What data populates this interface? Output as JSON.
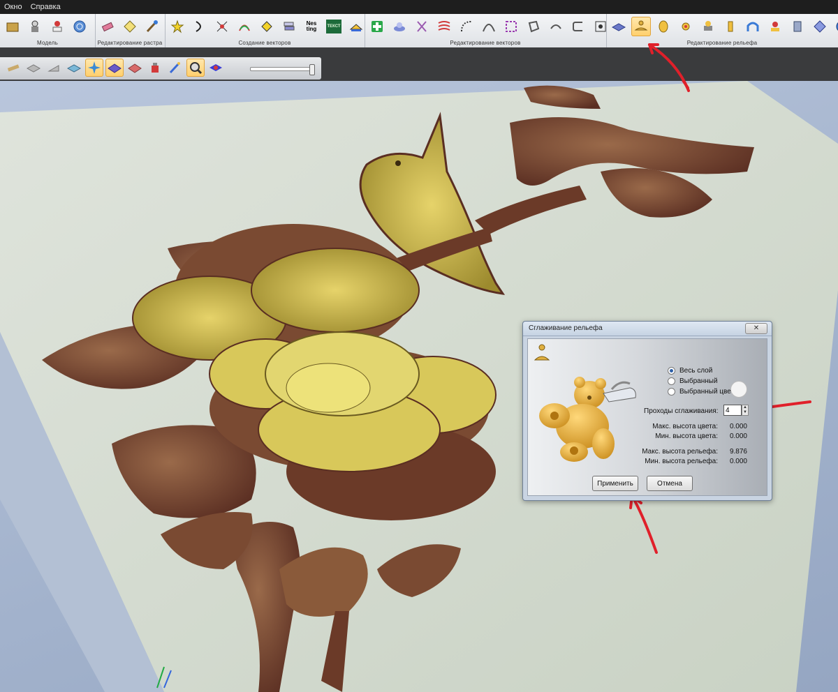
{
  "menu": {
    "items": [
      "Окно",
      "Справка"
    ]
  },
  "ribbon": {
    "groups": [
      {
        "label": "Модель"
      },
      {
        "label": "Редактирование растра"
      },
      {
        "label": "Создание векторов"
      },
      {
        "label": "Редактирование векторов"
      },
      {
        "label": "Редактирование рельефа"
      }
    ],
    "vector_tool_text": {
      "nesting": "Nes ting",
      "text": "ТЕКСТ"
    }
  },
  "dialog": {
    "title": "Сглаживание рельефа",
    "close_label": "✕",
    "radios": [
      {
        "label": "Весь слой",
        "checked": true
      },
      {
        "label": "Выбранный",
        "checked": false
      },
      {
        "label": "Выбранный цвет",
        "checked": false
      }
    ],
    "passes": {
      "label": "Проходы сглаживания:",
      "value": "4"
    },
    "stats": [
      {
        "label": "Макс. высота цвета:",
        "value": "0.000"
      },
      {
        "label": "Мин. высота цвета:",
        "value": "0.000"
      },
      {
        "label": "Макс. высота рельефа:",
        "value": "9.876"
      },
      {
        "label": "Мин. высота рельефа:",
        "value": "0.000"
      }
    ],
    "apply_label": "Применить",
    "cancel_label": "Отмена"
  },
  "colors": {
    "accent_arrow": "#e0202a",
    "relief_gold": "#c8a94a",
    "relief_brown": "#6b3a28"
  }
}
